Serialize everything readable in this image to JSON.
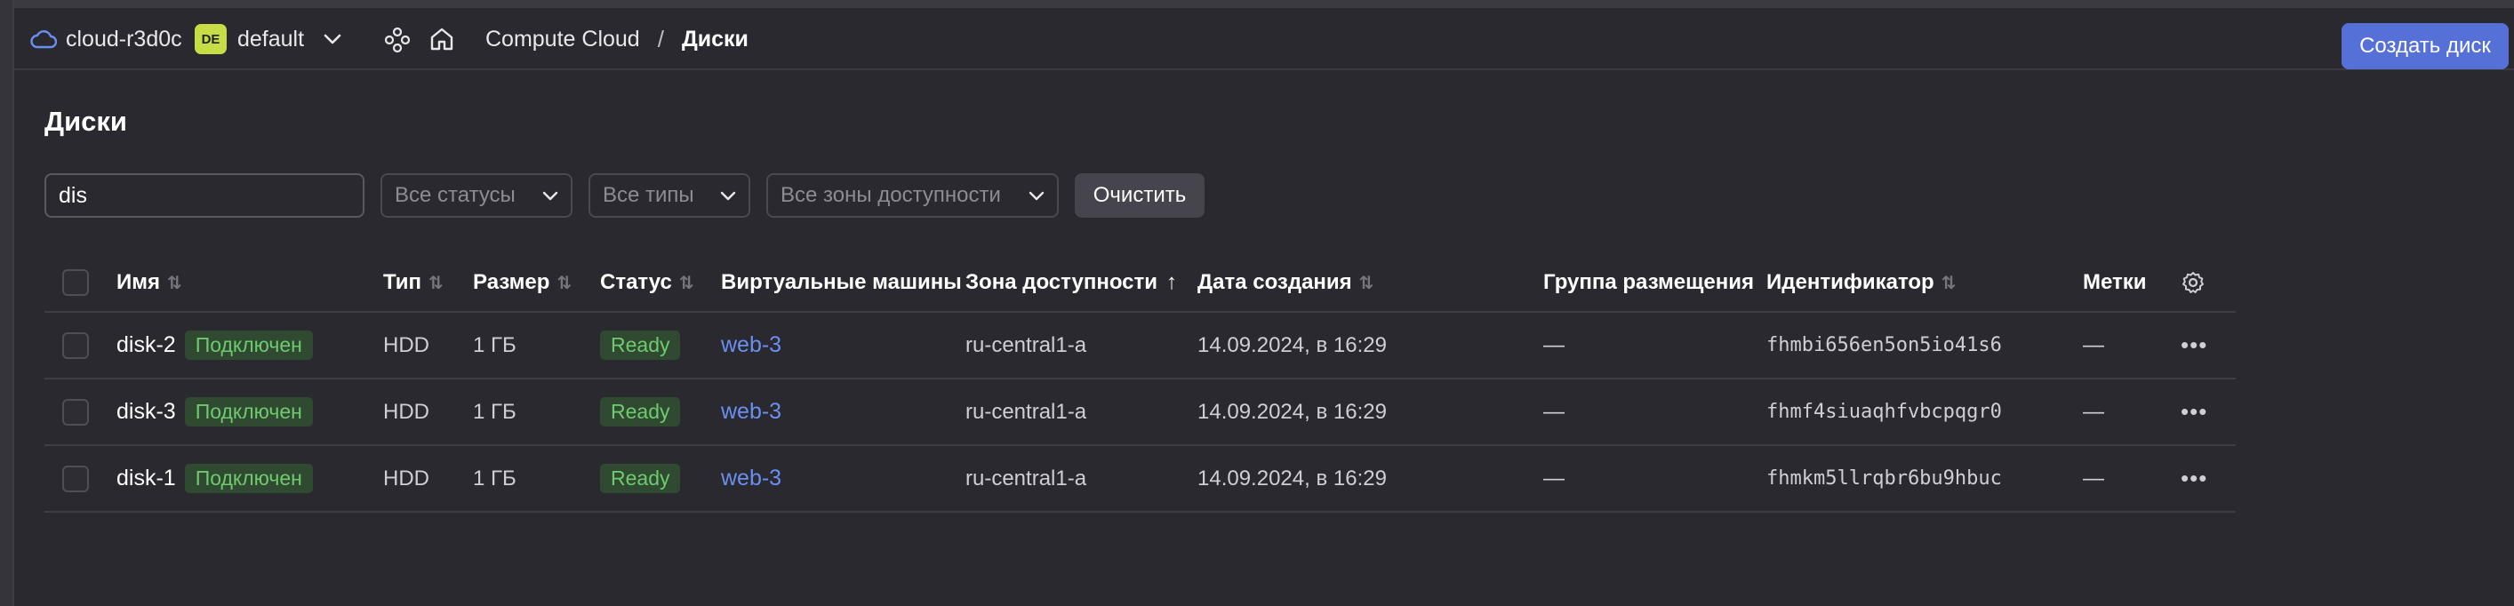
{
  "header": {
    "cloud_name": "cloud-r3d0c",
    "folder_badge": "DE",
    "folder_name": "default",
    "breadcrumb_service": "Compute Cloud",
    "breadcrumb_sep": "/",
    "breadcrumb_current": "Диски",
    "create_button": "Создать диск"
  },
  "page": {
    "title": "Диски"
  },
  "filters": {
    "search_value": "dis",
    "status_placeholder": "Все статусы",
    "type_placeholder": "Все типы",
    "zone_placeholder": "Все зоны доступности",
    "clear_button": "Очистить"
  },
  "table": {
    "columns": {
      "name": "Имя",
      "type": "Тип",
      "size": "Размер",
      "status": "Статус",
      "vms": "Виртуальные машины",
      "zone": "Зона доступности",
      "created": "Дата создания",
      "placement": "Группа размещения",
      "id": "Идентификатор",
      "labels": "Метки"
    },
    "sort_active_column": "zone",
    "rows": [
      {
        "name": "disk-2",
        "badge": "Подключен",
        "type": "HDD",
        "size": "1 ГБ",
        "status": "Ready",
        "vm": "web-3",
        "zone": "ru-central1-a",
        "created": "14.09.2024, в 16:29",
        "placement": "—",
        "id": "fhmbi656en5on5io41s6",
        "labels": "—"
      },
      {
        "name": "disk-3",
        "badge": "Подключен",
        "type": "HDD",
        "size": "1 ГБ",
        "status": "Ready",
        "vm": "web-3",
        "zone": "ru-central1-a",
        "created": "14.09.2024, в 16:29",
        "placement": "—",
        "id": "fhmf4siuaqhfvbcpqgr0",
        "labels": "—"
      },
      {
        "name": "disk-1",
        "badge": "Подключен",
        "type": "HDD",
        "size": "1 ГБ",
        "status": "Ready",
        "vm": "web-3",
        "zone": "ru-central1-a",
        "created": "14.09.2024, в 16:29",
        "placement": "—",
        "id": "fhmkm5llrqbr6bu9hbuc",
        "labels": "—"
      }
    ]
  },
  "colors": {
    "background": "#2a2930",
    "accent": "#5570d7",
    "link": "#6a8ff0",
    "success_bg": "#2f4a30",
    "success_text": "#6fca6f",
    "folder_badge": "#c6dd45"
  }
}
